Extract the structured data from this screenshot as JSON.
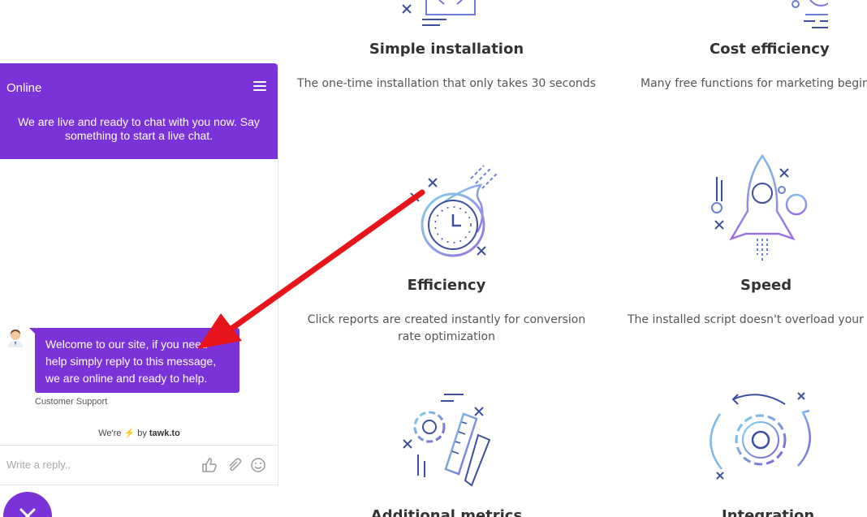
{
  "features": {
    "simple": {
      "title": "Simple installation",
      "desc": "The one-time installation that only takes 30 seconds",
      "icon": "code-monitor-icon"
    },
    "cost": {
      "title": "Cost efficiency",
      "desc": "Many free functions for marketing beginne",
      "icon": "piggy-bank-icon"
    },
    "efficiency": {
      "title": "Efficiency",
      "desc": "Click reports are created instantly for conversion rate optimization",
      "icon": "clock-comet-icon"
    },
    "speed": {
      "title": "Speed",
      "desc": "The installed script doesn't overload your web",
      "icon": "rocket-icon"
    },
    "metrics": {
      "title": "Additional metrics",
      "icon": "gear-ruler-pen-icon"
    },
    "integration": {
      "title": "Integration",
      "icon": "gear-cycle-icon"
    }
  },
  "chat": {
    "status": "Online",
    "intro": "We are live and ready to chat with you now. Say something to start a live chat.",
    "message": "Welcome to our site, if you need help simply reply to this message, we are online and ready to help.",
    "sender": "Customer Support",
    "powered_prefix": "We're",
    "powered_bolt": "⚡",
    "powered_by": "by",
    "powered_brand": "tawk.to",
    "input_placeholder": "Write a reply..",
    "accent_color": "#7b32d9"
  },
  "annotation": {
    "arrow_color": "#e8141b"
  }
}
